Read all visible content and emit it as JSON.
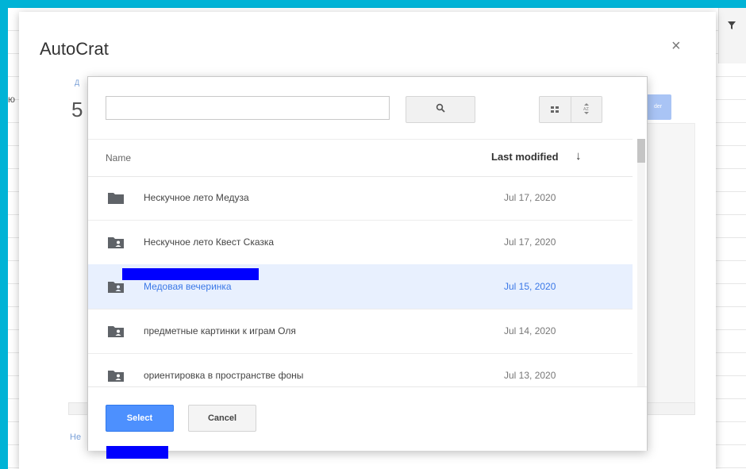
{
  "background": {
    "left_text": "ю",
    "filter_icon": "filter-icon"
  },
  "dialog": {
    "title": "AutoCrat",
    "close_icon": "close-icon",
    "close_glyph": "×",
    "behind_label": "Д",
    "behind_number": "5",
    "behind_help": "He",
    "behind_button_text": "der"
  },
  "picker": {
    "search": {
      "value": "",
      "placeholder": "",
      "icon": "search-icon"
    },
    "view_buttons": [
      {
        "icon": "grid-view-icon",
        "glyph": "▪▪"
      },
      {
        "icon": "sort-az-icon",
        "glyph": "⇅"
      }
    ],
    "columns": {
      "name": "Name",
      "last_modified": "Last modified",
      "sort_icon": "arrow-down-icon",
      "sort_glyph": "↓"
    },
    "rows": [
      {
        "name": "Нескучное лето Медуза",
        "date": "Jul 17, 2020",
        "icon": "folder-icon",
        "selected": false
      },
      {
        "name": "Нескучное лето Квест Сказка",
        "date": "Jul 17, 2020",
        "icon": "shared-folder-icon",
        "selected": false
      },
      {
        "name": "Медовая вечеринка",
        "date": "Jul 15, 2020",
        "icon": "shared-folder-icon",
        "selected": true
      },
      {
        "name": "предметные картинки к играм Оля",
        "date": "Jul 14, 2020",
        "icon": "shared-folder-icon",
        "selected": false
      },
      {
        "name": "ориентировка в пространстве фоны",
        "date": "Jul 13, 2020",
        "icon": "shared-folder-icon",
        "selected": false
      }
    ],
    "buttons": {
      "select": "Select",
      "cancel": "Cancel"
    },
    "colors": {
      "accent": "#4d90fe",
      "selected_row": "#e8f0fe",
      "selected_text": "#3b78e7",
      "frame": "#00b3d6",
      "redaction": "#0000ff"
    }
  }
}
